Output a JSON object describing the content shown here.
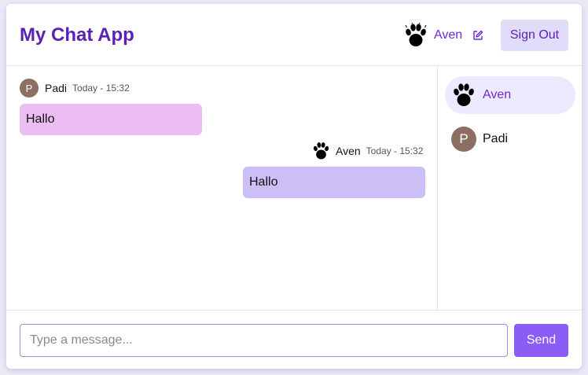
{
  "app": {
    "title": "My Chat App"
  },
  "header": {
    "current_user": "Aven",
    "current_user_icon": "paw-icon",
    "edit_icon": "pencil-square-icon",
    "sign_out_label": "Sign Out"
  },
  "messages": [
    {
      "author": "Padi",
      "avatar_initial": "P",
      "time": "Today - 15:32",
      "text": "Hallo",
      "direction": "incoming"
    },
    {
      "author": "Aven",
      "avatar_icon": "paw-icon",
      "time": "Today - 15:32",
      "text": "Hallo",
      "direction": "outgoing"
    }
  ],
  "sidebar": {
    "users": [
      {
        "name": "Aven",
        "avatar_icon": "paw-icon",
        "active": true
      },
      {
        "name": "Padi",
        "avatar_initial": "P",
        "active": false
      }
    ]
  },
  "composer": {
    "placeholder": "Type a message...",
    "value": "",
    "send_label": "Send"
  },
  "colors": {
    "brand": "#5b21b6",
    "accent": "#8b5cf6",
    "incoming_bubble": "#ecbdf2",
    "outgoing_bubble": "#cbbff5",
    "active_user_bg": "#ede9fe",
    "avatar_bg": "#8d6e63"
  }
}
